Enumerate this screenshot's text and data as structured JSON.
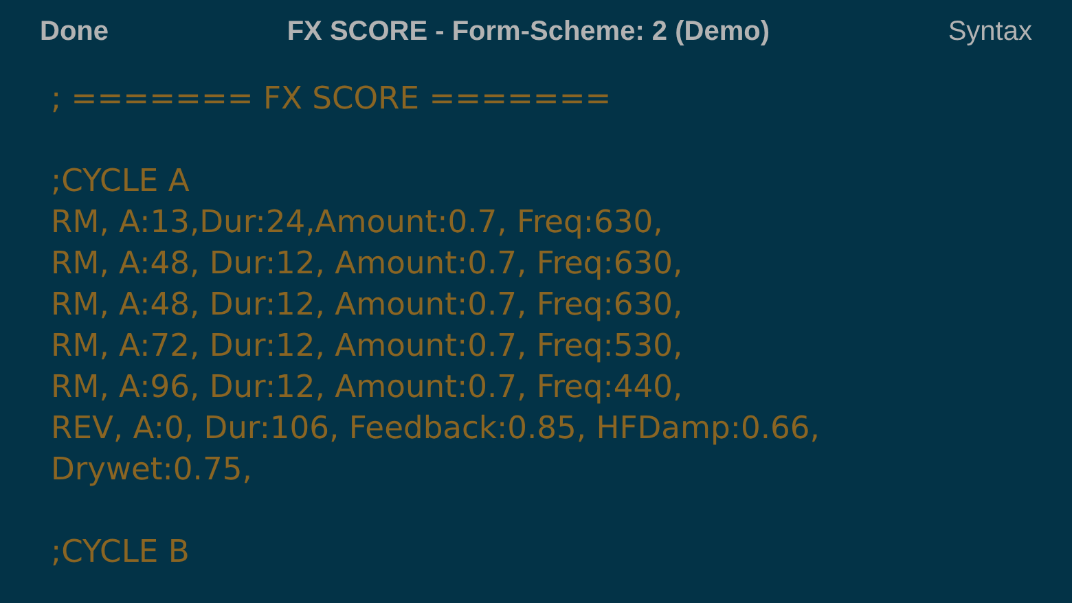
{
  "header": {
    "left_button": "Done",
    "title": "FX SCORE - Form-Scheme: 2 (Demo)",
    "right_button": "Syntax"
  },
  "editor": {
    "paragraphs": [
      [
        "; ======= FX SCORE ======="
      ],
      [
        ";CYCLE A",
        "RM, A:13,Dur:24,Amount:0.7, Freq:630,",
        "RM, A:48, Dur:12, Amount:0.7, Freq:630,",
        "RM, A:48, Dur:12, Amount:0.7, Freq:630,",
        "RM, A:72, Dur:12, Amount:0.7, Freq:530,",
        "RM, A:96, Dur:12, Amount:0.7, Freq:440,",
        "REV, A:0, Dur:106, Feedback:0.85, HFDamp:0.66,",
        "Drywet:0.75,"
      ],
      [
        ";CYCLE B"
      ]
    ]
  }
}
